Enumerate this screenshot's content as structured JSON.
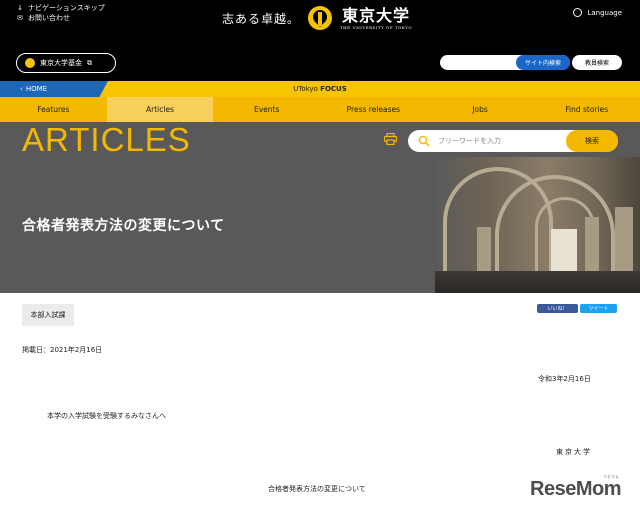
{
  "header": {
    "skip_nav": "ナビゲーションスキップ",
    "contact": "お問い合わせ",
    "slogan": "志ある卓越。",
    "university_name": "東京大学",
    "university_name_en": "THE UNIVERSITY OF TOKYO",
    "language": "Language",
    "fund_label": "東京大学基金",
    "site_search_button": "サイト内検索",
    "staff_search_button": "教員検索"
  },
  "breadcrumb": {
    "home": "HOME",
    "focus_prefix": "UTokyo ",
    "focus_bold": "FOCUS"
  },
  "nav": {
    "tabs": [
      {
        "label": "Features",
        "active": false
      },
      {
        "label": "Articles",
        "active": true
      },
      {
        "label": "Events",
        "active": false
      },
      {
        "label": "Press releases",
        "active": false
      },
      {
        "label": "Jobs",
        "active": false
      },
      {
        "label": "Find stories",
        "active": false
      }
    ]
  },
  "section": {
    "title": "ARTICLES",
    "search_placeholder": "フリーワードを入力",
    "search_button": "検索"
  },
  "article": {
    "title": "合格者発表方法の変更について",
    "tag": "本部入試課",
    "like_label": "いいね！",
    "tweet_label": "ツイート",
    "posted_date": "掲載日：2021年2月16日",
    "letter_date": "令和3年2月16日",
    "greeting": "本学の入学試験を受験するみなさんへ",
    "signature": "東京大学",
    "subject": "合格者発表方法の変更について"
  },
  "watermark": {
    "text": "ReseMom",
    "kana": "リセマム"
  },
  "colors": {
    "brand_yellow": "#f5b800",
    "header_black": "#000000",
    "home_blue": "#1d67b6",
    "band_gray": "#595959"
  }
}
